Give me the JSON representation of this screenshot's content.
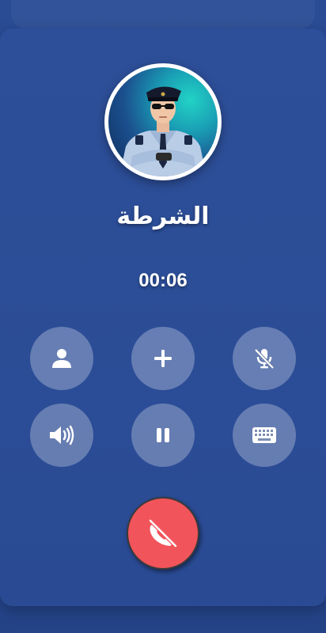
{
  "call": {
    "caller_name": "الشرطة",
    "timer": "00:06"
  },
  "controls": {
    "row1": [
      {
        "name": "contact",
        "icon": "person-icon"
      },
      {
        "name": "add-call",
        "icon": "plus-icon"
      },
      {
        "name": "mute",
        "icon": "mic-off-icon"
      }
    ],
    "row2": [
      {
        "name": "speaker",
        "icon": "speaker-icon"
      },
      {
        "name": "hold",
        "icon": "pause-icon"
      },
      {
        "name": "keypad",
        "icon": "keyboard-icon"
      }
    ],
    "end_call": {
      "icon": "phone-hangup-icon"
    }
  },
  "colors": {
    "background": "#2a4c95",
    "control_fill": "rgba(255,255,255,0.28)",
    "end_call": "#f2545b",
    "text": "#ffffff"
  }
}
